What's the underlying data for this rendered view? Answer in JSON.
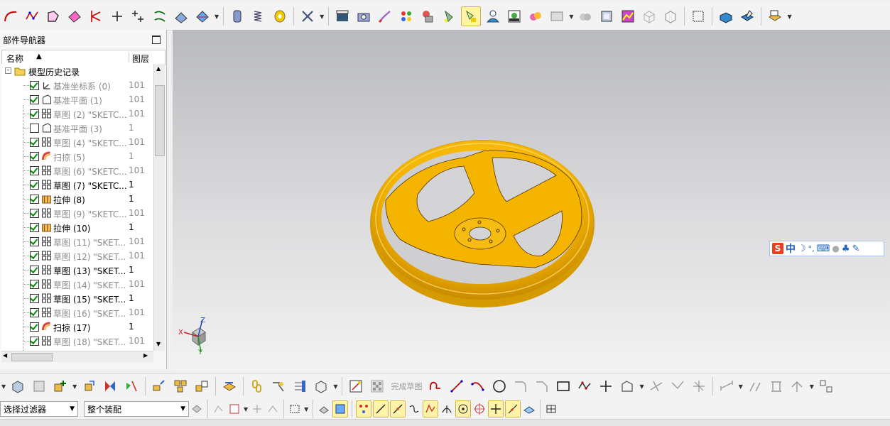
{
  "navigator": {
    "title": "部件导航器",
    "col_name": "名称",
    "col_layer": "图层",
    "root": "模型历史记录",
    "items": [
      {
        "label": "基准坐标系 (0)",
        "layer": "101",
        "checked": true,
        "dim": true,
        "icon": "datum-csys-icon"
      },
      {
        "label": "基准平面 (1)",
        "layer": "101",
        "checked": true,
        "dim": true,
        "icon": "datum-plane-icon"
      },
      {
        "label": "草图 (2) \"SKETC...",
        "layer": "101",
        "checked": true,
        "dim": true,
        "icon": "sketch-icon"
      },
      {
        "label": "基准平面 (3)",
        "layer": "1",
        "checked": false,
        "dim": true,
        "icon": "datum-plane-icon"
      },
      {
        "label": "草图 (4) \"SKETC...",
        "layer": "101",
        "checked": true,
        "dim": true,
        "icon": "sketch-icon"
      },
      {
        "label": "扫掠 (5)",
        "layer": "1",
        "checked": true,
        "dim": true,
        "icon": "sweep-icon"
      },
      {
        "label": "草图 (6) \"SKETC...",
        "layer": "101",
        "checked": true,
        "dim": true,
        "icon": "sketch-icon"
      },
      {
        "label": "草图 (7) \"SKETC...",
        "layer": "1",
        "checked": true,
        "dim": false,
        "icon": "sketch-icon"
      },
      {
        "label": "拉伸 (8)",
        "layer": "1",
        "checked": true,
        "dim": false,
        "icon": "extrude-icon"
      },
      {
        "label": "草图 (9) \"SKETC...",
        "layer": "101",
        "checked": true,
        "dim": true,
        "icon": "sketch-icon"
      },
      {
        "label": "拉伸 (10)",
        "layer": "1",
        "checked": true,
        "dim": false,
        "icon": "extrude-icon"
      },
      {
        "label": "草图 (11) \"SKET...",
        "layer": "101",
        "checked": true,
        "dim": true,
        "icon": "sketch-icon"
      },
      {
        "label": "草图 (12) \"SKET...",
        "layer": "101",
        "checked": true,
        "dim": true,
        "icon": "sketch-icon"
      },
      {
        "label": "草图 (13) \"SKET...",
        "layer": "1",
        "checked": true,
        "dim": false,
        "icon": "sketch-icon"
      },
      {
        "label": "草图 (14) \"SKET...",
        "layer": "101",
        "checked": true,
        "dim": true,
        "icon": "sketch-icon"
      },
      {
        "label": "草图 (15) \"SKET...",
        "layer": "1",
        "checked": true,
        "dim": false,
        "icon": "sketch-icon"
      },
      {
        "label": "草图 (16) \"SKET...",
        "layer": "101",
        "checked": true,
        "dim": true,
        "icon": "sketch-icon"
      },
      {
        "label": "扫掠 (17)",
        "layer": "1",
        "checked": true,
        "dim": false,
        "icon": "sweep-icon"
      },
      {
        "label": "草图 (18) \"SKET...",
        "layer": "101",
        "checked": true,
        "dim": true,
        "icon": "sketch-icon"
      }
    ]
  },
  "sketch_toolbar": {
    "finish_sketch": "完成草图"
  },
  "selection_bar": {
    "filter": "选择过滤器",
    "scope": "整个装配"
  },
  "viewport": {
    "axis_x": "X",
    "axis_y": "Y",
    "axis_z": "Z"
  },
  "ime": {
    "lang": "中",
    "dot": "°,"
  },
  "colors": {
    "part": "#f4b400",
    "part_shadow": "#c98a00",
    "viewport_top": "#b9babd",
    "viewport_bottom": "#f2f2f2"
  }
}
